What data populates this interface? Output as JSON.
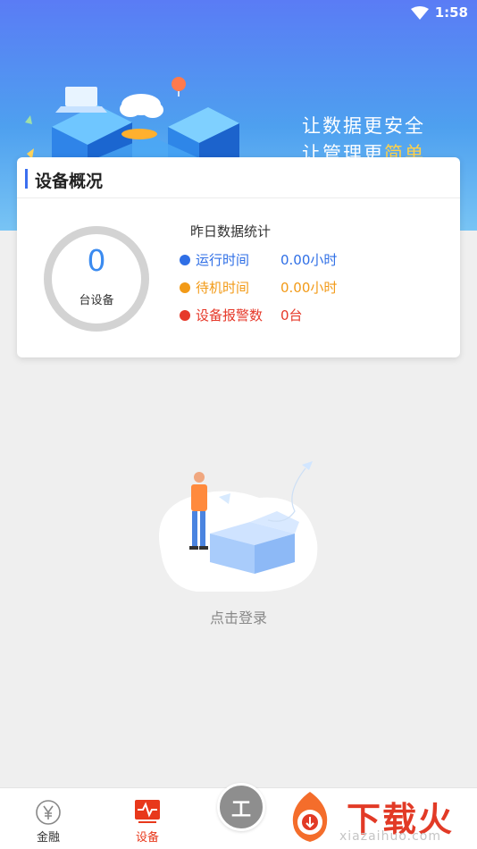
{
  "status_bar": {
    "time": "1:58"
  },
  "banner": {
    "slogan_line1": "让数据更安全",
    "slogan_line2_a": "让管理更",
    "slogan_line2_b": "简单"
  },
  "overview": {
    "title": "设备概况",
    "device_count": "0",
    "device_count_label": "台设备",
    "stats_title": "昨日数据统计",
    "stats": [
      {
        "label": "运行时间",
        "value": "0.00小时",
        "color": "#2f6fe6"
      },
      {
        "label": "待机时间",
        "value": "0.00小时",
        "color": "#f29a17"
      },
      {
        "label": "设备报警数",
        "value": "0台",
        "color": "#e6392a"
      }
    ]
  },
  "empty_state": {
    "login_text": "点击登录"
  },
  "tabbar": {
    "tabs": [
      {
        "label": "金融",
        "icon": "yen-icon",
        "active": false
      },
      {
        "label": "设备",
        "icon": "monitor-pulse-icon",
        "active": true
      }
    ],
    "center_icon": "工"
  },
  "watermark": {
    "text": "下载火",
    "url": "xiazaihuo.com"
  }
}
